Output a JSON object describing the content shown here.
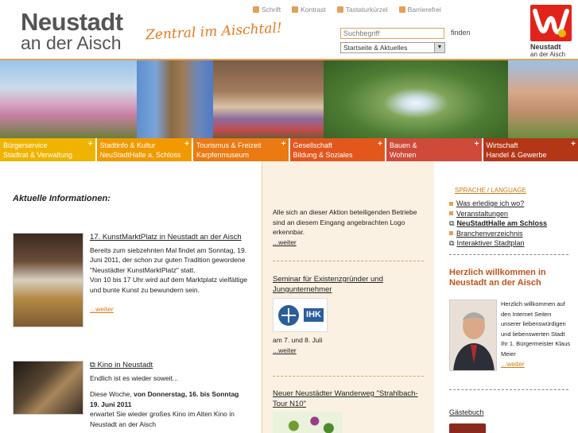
{
  "header": {
    "logo_line1": "Neustadt",
    "logo_line2": "an der Aisch",
    "slogan": "Zentral im Aischtal!",
    "topnav": [
      {
        "label": "Schrift",
        "icon": "font-size-icon",
        "color": "#e2a058"
      },
      {
        "label": "Kontrast",
        "icon": "contrast-icon",
        "color": "#e2a058"
      },
      {
        "label": "Tastaturkürzel",
        "icon": "keyboard-icon",
        "color": "#e2a058"
      },
      {
        "label": "Barrierefrei",
        "icon": "accessibility-icon",
        "color": "#e2a058"
      }
    ],
    "search": {
      "placeholder": "Suchbegriff",
      "button": "finden"
    },
    "scope_select": {
      "selected": "Startseite & Aktuelles"
    },
    "city_logo": {
      "line1": "Neustadt",
      "line2": "an der Aisch",
      "brand_color": "#e2231a"
    }
  },
  "nav": [
    {
      "line1": "Bürgerservice",
      "line2": "Stadtrat & Verwaltung",
      "color": "#f0b400"
    },
    {
      "line1": "Stadtinfo & Kultur",
      "line2": "NeuStadtHalle a. Schloss",
      "color": "#f19a00"
    },
    {
      "line1": "Tourismus & Freizeit",
      "line2": "Karpfenmuseum",
      "color": "#ea7a11"
    },
    {
      "line1": "Gesellschaft",
      "line2": "Bildung & Soziales",
      "color": "#e3571d"
    },
    {
      "line1": "Bauen &",
      "line2": "Wohnen",
      "color": "#cf4a38"
    },
    {
      "line1": "Wirtschaft",
      "line2": "Handel & Gewerbe",
      "color": "#b33617"
    }
  ],
  "main": {
    "heading": "Aktuelle Informationen:",
    "news": [
      {
        "title": "17. KunstMarktPlatz in Neustadt an der Aisch",
        "body": "Bereits zum siebzehnten Mal findet am Sonntag, 19. Juni 2011, der schon zur guten Tradition gewordene \"Neustädter KunstMarktPlatz\" statt.",
        "body2": "Von 10 bis 17 Uhr wird auf dem Marktplatz vielfältige und bunte Kunst zu bewundern sein.",
        "more": "...weiter"
      },
      {
        "title": "Kino in Neustadt",
        "body": "Endlich ist es wieder soweit...",
        "body2_pre": "Diese Woche, ",
        "body2_bold": "von Donnerstag, 16. bis Sonntag 19. Juni 2011",
        "body3": "erwartet Sie wieder großes Kino im Alten Kino in Neustadt an der Aisch"
      }
    ]
  },
  "middle": {
    "block1": {
      "body": "Alle sich an dieser Aktion beteiligenden Betriebe sind an diesem Eingang angebrachten Logo erkennbar.",
      "more": "...weiter"
    },
    "block2": {
      "title": "Seminar für Existenzgründer und Jungunternehmer",
      "logo_text": "IHK",
      "body": "am 7. und 8. Juli",
      "more": "...weiter"
    },
    "block3": {
      "title": "Neuer Neustädter Wanderweg \"Strahlbach-Tour N10\""
    }
  },
  "sidebar": {
    "lang": "SPRACHE / LANGUAGE",
    "links": [
      {
        "label": "Was erledige ich wo?",
        "icon": "bullet-icon"
      },
      {
        "label": "Veranstaltungen",
        "icon": "bullet-icon"
      },
      {
        "label": "NeuStadtHalle am Schloss",
        "icon": "external-link-icon",
        "bold": true
      },
      {
        "label": "Branchenverzeichnis",
        "icon": "bullet-icon"
      },
      {
        "label": "Interaktiver Stadtplan",
        "icon": "external-link-icon"
      }
    ],
    "welcome_heading": "Herzlich willkommen in Neustadt an der Aisch",
    "welcome_text": "Herzlich willkommen auf den Internet Seiten unserer liebenswürdigen und liebenswerten Stadt",
    "welcome_sign": "Ihr 1. Bürgermeister Klaus Meier",
    "welcome_more": "...weiter",
    "guestbook": "Gästebuch"
  }
}
